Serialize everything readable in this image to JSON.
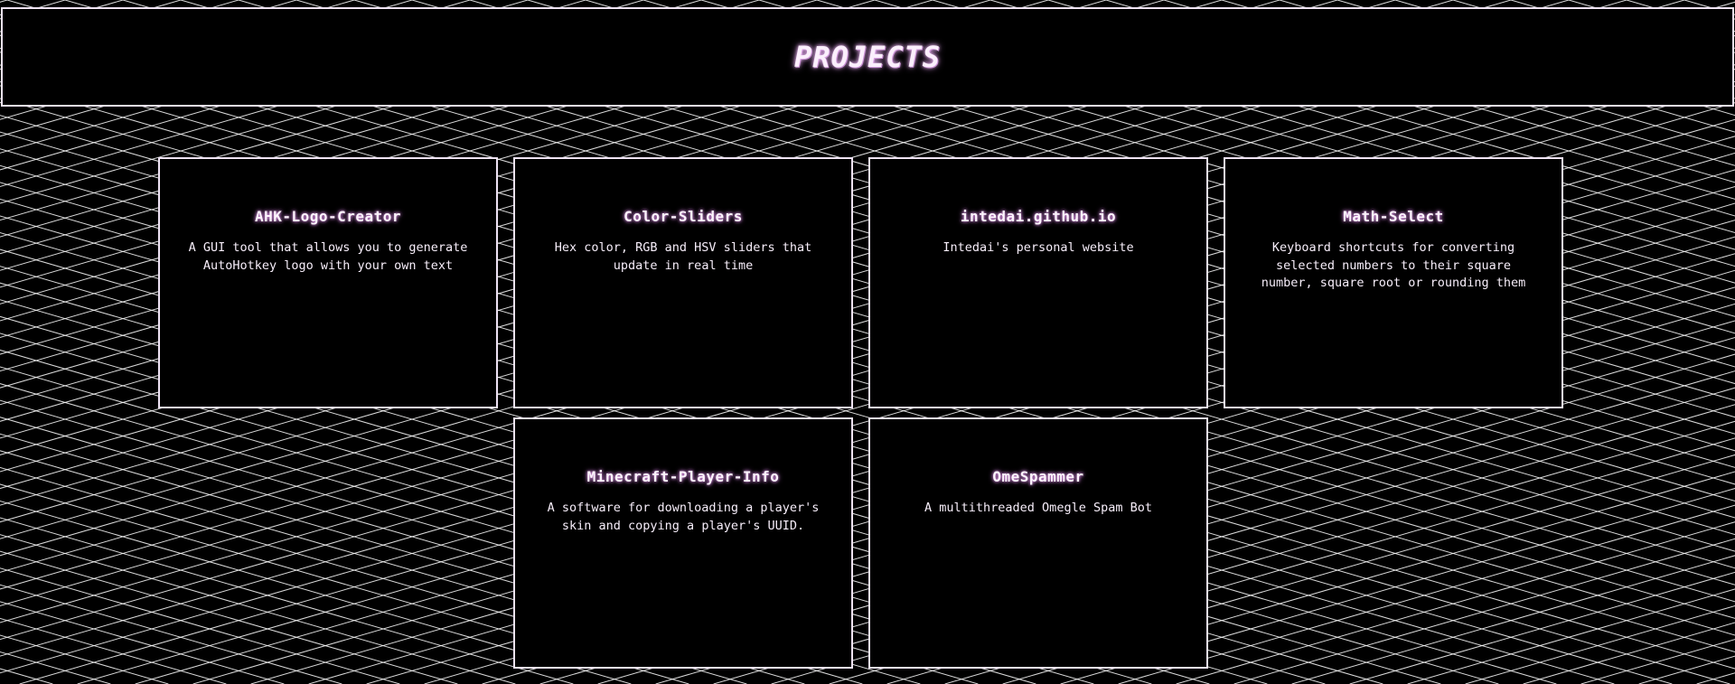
{
  "header": {
    "title": "PROJECTS"
  },
  "theme": {
    "background": "#000000",
    "grid_line": "#ffffff",
    "border": "#efe3f5",
    "glow": "#d995e2"
  },
  "projects": [
    {
      "title": "AHK-Logo-Creator",
      "description": "A GUI tool that allows you to generate AutoHotkey logo with your own text"
    },
    {
      "title": "Color-Sliders",
      "description": "Hex color, RGB and HSV sliders that update in real time"
    },
    {
      "title": "intedai.github.io",
      "description": "Intedai's personal website"
    },
    {
      "title": "Math-Select",
      "description": "Keyboard shortcuts for converting selected numbers to their square number, square root or rounding them"
    },
    {
      "title": "Minecraft-Player-Info",
      "description": "A software for downloading a player's skin and copying a player's UUID."
    },
    {
      "title": "OmeSpammer",
      "description": "A multithreaded Omegle Spam Bot"
    }
  ]
}
